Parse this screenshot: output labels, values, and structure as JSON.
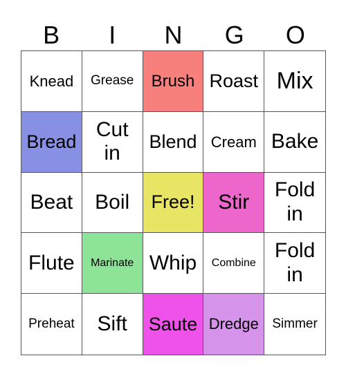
{
  "header": [
    "B",
    "I",
    "N",
    "G",
    "O"
  ],
  "cells": [
    {
      "text": "Knead",
      "color": "#ffffff",
      "size": "s22"
    },
    {
      "text": "Grease",
      "color": "#ffffff",
      "size": "s19"
    },
    {
      "text": "Brush",
      "color": "#f77f7c",
      "size": "s24"
    },
    {
      "text": "Roast",
      "color": "#ffffff",
      "size": "s27"
    },
    {
      "text": "Mix",
      "color": "#ffffff",
      "size": "s34"
    },
    {
      "text": "Bread",
      "color": "#8790e3",
      "size": "s27"
    },
    {
      "text": "Cut in",
      "color": "#ffffff",
      "size": "s30"
    },
    {
      "text": "Blend",
      "color": "#ffffff",
      "size": "s27"
    },
    {
      "text": "Cream",
      "color": "#ffffff",
      "size": "s22"
    },
    {
      "text": "Bake",
      "color": "#ffffff",
      "size": "s30"
    },
    {
      "text": "Beat",
      "color": "#ffffff",
      "size": "s30"
    },
    {
      "text": "Boil",
      "color": "#ffffff",
      "size": "s30"
    },
    {
      "text": "Free!",
      "color": "#e8e564",
      "size": "s27"
    },
    {
      "text": "Stir",
      "color": "#ec66cc",
      "size": "s30"
    },
    {
      "text": "Fold in",
      "color": "#ffffff",
      "size": "s30"
    },
    {
      "text": "Flute",
      "color": "#ffffff",
      "size": "s30"
    },
    {
      "text": "Marinate",
      "color": "#8de396",
      "size": "s16"
    },
    {
      "text": "Whip",
      "color": "#ffffff",
      "size": "s30"
    },
    {
      "text": "Combine",
      "color": "#ffffff",
      "size": "s16"
    },
    {
      "text": "Fold in",
      "color": "#ffffff",
      "size": "s30"
    },
    {
      "text": "Preheat",
      "color": "#ffffff",
      "size": "s19"
    },
    {
      "text": "Sift",
      "color": "#ffffff",
      "size": "s30"
    },
    {
      "text": "Saute",
      "color": "#ef52e8",
      "size": "s27"
    },
    {
      "text": "Dredge",
      "color": "#d594ea",
      "size": "s22"
    },
    {
      "text": "Simmer",
      "color": "#ffffff",
      "size": "s19"
    }
  ]
}
